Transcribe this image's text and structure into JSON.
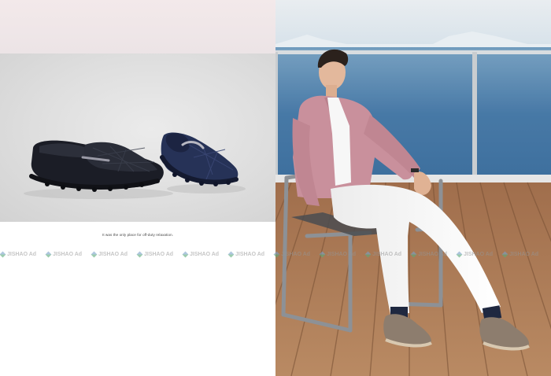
{
  "caption": "It was the only place for off-duty relaxation.",
  "watermark": {
    "text": "JISHAO Ad",
    "repeat": 12
  },
  "colors": {
    "jacket": "#c9909c",
    "sea": "#3a6fa0",
    "deck": "#b07c58",
    "shoe_left": "#1b1d26",
    "shoe_right": "#263257"
  }
}
